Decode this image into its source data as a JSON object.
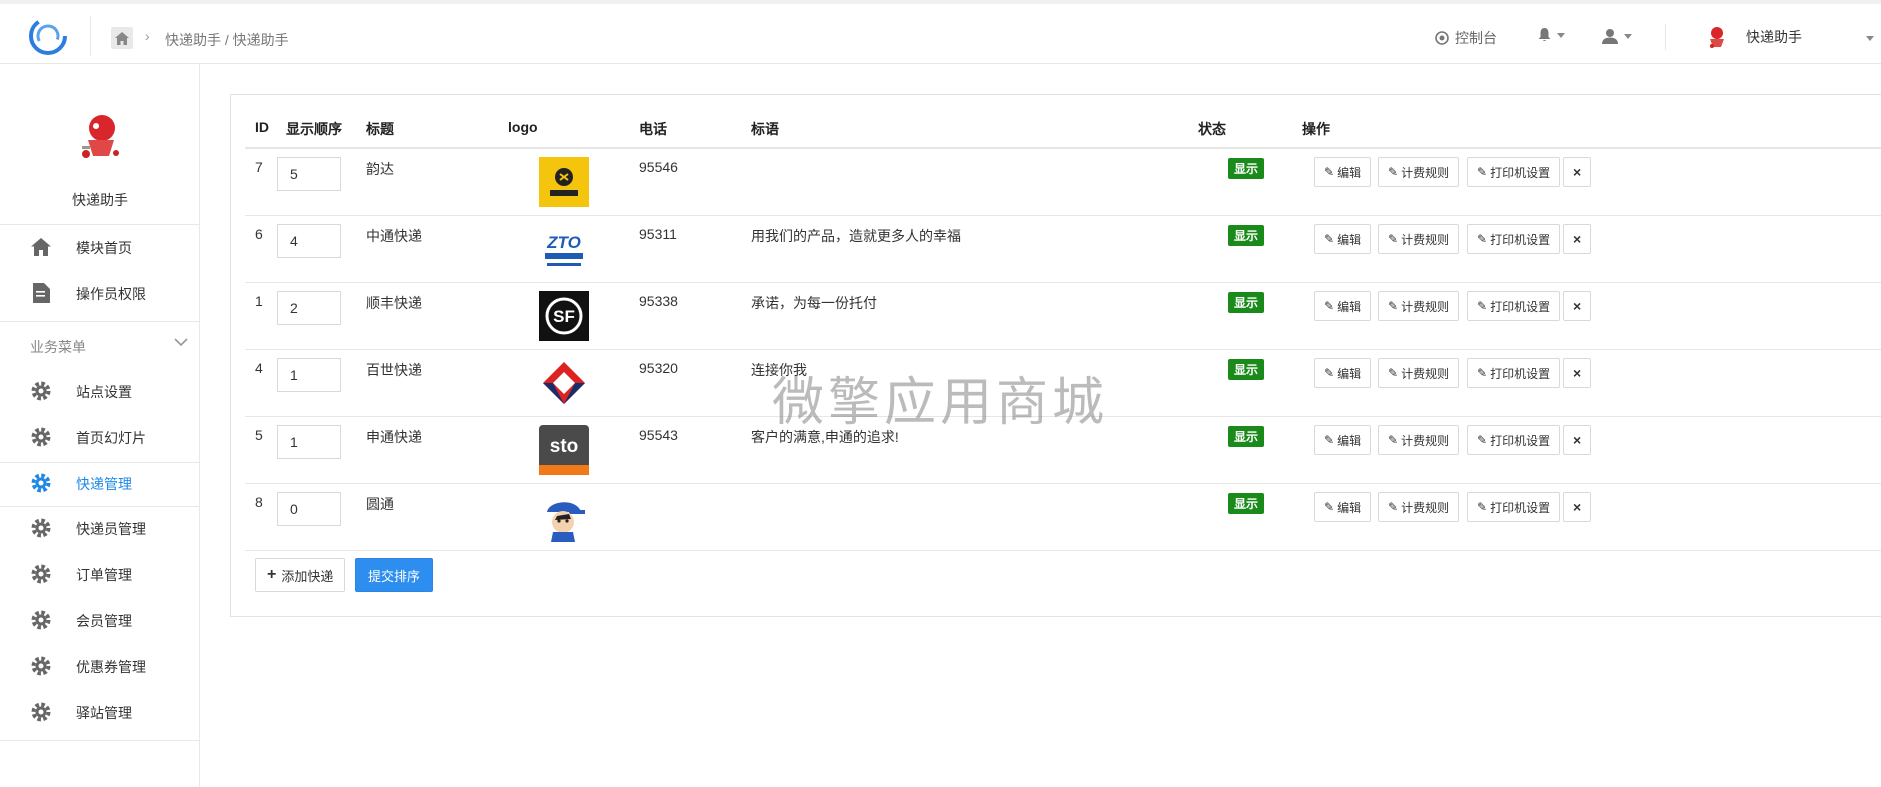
{
  "topbar": {
    "breadcrumb": "快递助手 / 快递助手",
    "console_label": "控制台",
    "module_name": "快递助手"
  },
  "sidebar": {
    "module_name": "快递助手",
    "nav": [
      {
        "label": "模块首页",
        "icon": "home-icon"
      },
      {
        "label": "操作员权限",
        "icon": "document-icon"
      }
    ],
    "group_title": "业务菜单",
    "menu": [
      {
        "label": "站点设置",
        "active": false
      },
      {
        "label": "首页幻灯片",
        "active": false
      },
      {
        "label": "快递管理",
        "active": true
      },
      {
        "label": "快递员管理",
        "active": false
      },
      {
        "label": "订单管理",
        "active": false
      },
      {
        "label": "会员管理",
        "active": false
      },
      {
        "label": "优惠券管理",
        "active": false
      },
      {
        "label": "驿站管理",
        "active": false
      }
    ]
  },
  "table": {
    "headers": [
      "ID",
      "显示顺序",
      "标题",
      "logo",
      "电话",
      "标语",
      "状态",
      "操作"
    ],
    "rows": [
      {
        "id": "7",
        "order": "5",
        "title": "韵达",
        "logo": "yunda-logo",
        "phone": "95546",
        "slogan": "",
        "status": "显示"
      },
      {
        "id": "6",
        "order": "4",
        "title": "中通快递",
        "logo": "zto-logo",
        "phone": "95311",
        "slogan": "用我们的产品，造就更多人的幸福",
        "status": "显示"
      },
      {
        "id": "1",
        "order": "2",
        "title": "顺丰快递",
        "logo": "sf-logo",
        "phone": "95338",
        "slogan": "承诺，为每一份托付",
        "status": "显示"
      },
      {
        "id": "4",
        "order": "1",
        "title": "百世快递",
        "logo": "best-logo",
        "phone": "95320",
        "slogan": "连接你我",
        "status": "显示"
      },
      {
        "id": "5",
        "order": "1",
        "title": "申通快递",
        "logo": "sto-logo",
        "phone": "95543",
        "slogan": "客户的满意,申通的追求!",
        "status": "显示"
      },
      {
        "id": "8",
        "order": "0",
        "title": "圆通",
        "logo": "yto-logo",
        "phone": "",
        "slogan": "",
        "status": "显示"
      }
    ],
    "actions": {
      "edit": "编辑",
      "fee": "计费规则",
      "printer": "打印机设置",
      "delete": "×"
    }
  },
  "buttons": {
    "add": "添加快递",
    "submit_sort": "提交排序"
  },
  "watermark": "微擎应用商城",
  "colors": {
    "accent": "#2d8ef0",
    "status_green": "#1a8a1a",
    "active_nav": "#1e88e5"
  }
}
